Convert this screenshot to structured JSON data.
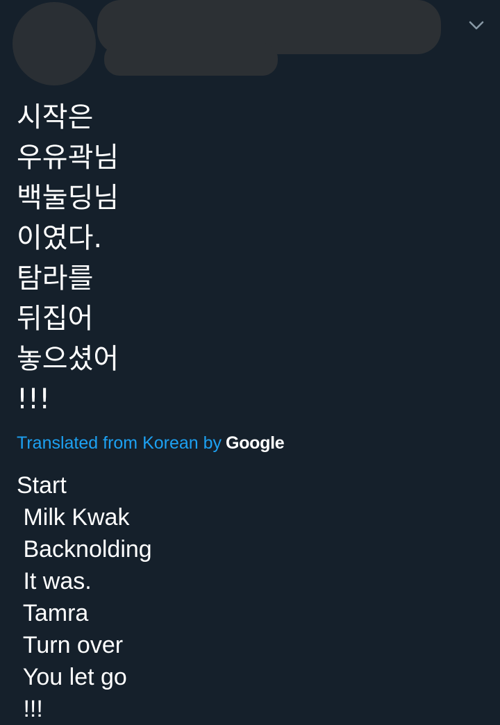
{
  "tweet": {
    "original_lines": [
      "시작은",
      "우유곽님",
      "백눌딩님",
      "이였다.",
      "탐라를",
      "뒤집어",
      "놓으셨어",
      "!!!"
    ],
    "translation_label": "Translated from Korean by",
    "translation_provider": "Google",
    "translated_lines": [
      "Start",
      " Milk Kwak",
      " Backnolding",
      " It was.",
      " Tamra",
      " Turn over",
      " You let go",
      " !!!"
    ]
  },
  "icons": {
    "menu": "chevron-down-icon"
  },
  "colors": {
    "background": "#15202b",
    "link": "#1da1f2",
    "text": "#ffffff",
    "redaction": "#2c3034"
  }
}
